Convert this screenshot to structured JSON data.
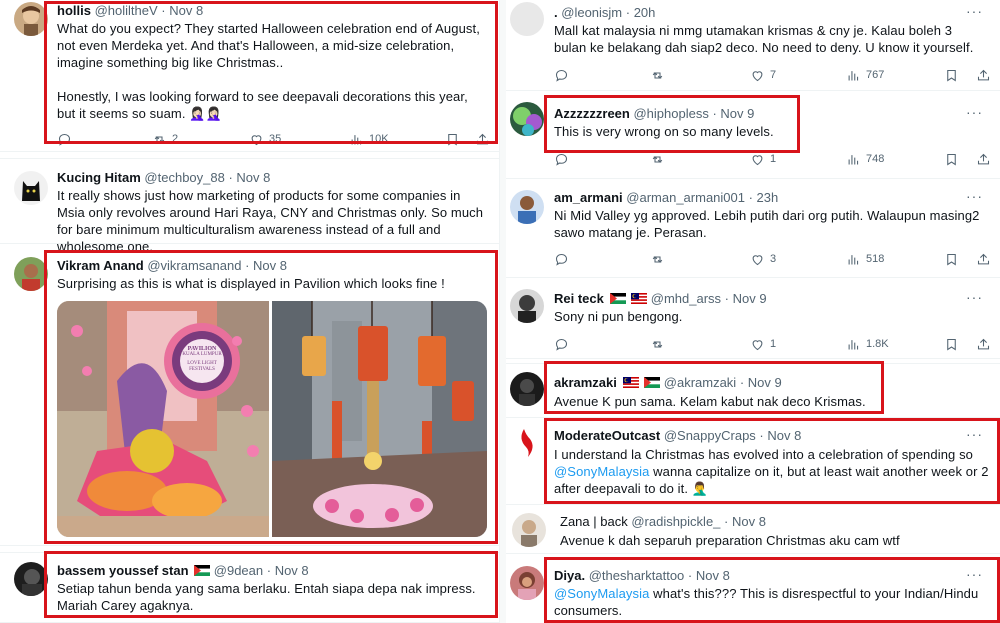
{
  "tweets_left": [
    {
      "id": "hollis",
      "name": "hollis",
      "handle": "@holiltheV",
      "date": "· Nov 8",
      "text": "What do you expect? They started Halloween celebration end of August, not even Merdeka yet. And that's Halloween, a mid-size celebration, imagine something big like Christmas..",
      "text2": "Honestly, I was looking forward to see deepavali decorations this year, but it seems so suam. 🤦🏻‍♀️🤦🏻‍♀️",
      "replies": "",
      "retweets": "2",
      "likes": "35",
      "views": "10K"
    },
    {
      "id": "kucing",
      "name": "Kucing Hitam",
      "handle": "@techboy_88",
      "date": "· Nov 8",
      "text": "It really shows just how marketing of products for some companies in Msia only revolves around Hari Raya, CNY and Christmas only. So much for bare minimum multiculturalism awareness instead of a full and wholesome one."
    },
    {
      "id": "vikram",
      "name": "Vikram Anand",
      "handle": "@vikramsanand",
      "date": "· Nov 8",
      "text": "Surprising as this is what is displayed in Pavilion which looks fine !",
      "sign_line1": "PAVILION",
      "sign_line2": "KUALA LUMPUR",
      "sign_line3": "LOVE LIGHT",
      "sign_line4": "FESTIVALS"
    },
    {
      "id": "bassem",
      "name": "bassem youssef stan",
      "handle": "@9dean",
      "date": "· Nov 8",
      "text": "Setiap tahun benda yang sama berlaku. Entah siapa depa nak impress. Mariah Carey agaknya."
    }
  ],
  "tweets_right": [
    {
      "id": "dot",
      "name": ".",
      "handle": "@leonisjm",
      "date": "· 20h",
      "text": "Mall kat malaysia ni mmg utamakan krismas & cny je. Kalau boleh 3 bulan ke belakang dah siap2 deco. No need to deny. U know it yourself.",
      "replies": "",
      "retweets": "",
      "likes": "7",
      "views": "767"
    },
    {
      "id": "azzz",
      "name": "Azzzzzzreen",
      "handle": "@hiphopless",
      "date": "· Nov 9",
      "text": "This is very wrong on so many levels.",
      "replies": "",
      "retweets": "",
      "likes": "1",
      "views": "748"
    },
    {
      "id": "armani",
      "name": "am_armani",
      "handle": "@arman_armani001",
      "date": "· 23h",
      "text": "Ni Mid Valley yg approved. Lebih  putih dari org putih. Walaupun masing2 sawo matang je. Perasan.",
      "replies": "",
      "retweets": "",
      "likes": "3",
      "views": "518"
    },
    {
      "id": "reiteck",
      "name": "Rei teck",
      "handle": "@mhd_arss",
      "date": "· Nov 9",
      "text": "Sony ni pun bengong.",
      "replies": "",
      "retweets": "",
      "likes": "1",
      "views": "1.8K"
    },
    {
      "id": "akram",
      "name": "akramzaki",
      "handle": "@akramzaki",
      "date": "· Nov 9",
      "text": "Avenue K pun sama. Kelam kabut nak deco Krismas."
    },
    {
      "id": "moderate",
      "name": "ModerateOutcast",
      "handle": "@SnappyCraps",
      "date": "· Nov 8",
      "text_a": "I understand la Christmas has evolved into a celebration of spending so",
      "mention": "@SonyMalaysia",
      "text_b": " wanna capitalize on it, but at least wait another week or 2 after deepavali to do it. 🤦‍♂️"
    },
    {
      "id": "zana",
      "name": "Zana | back",
      "handle": "@radishpickle_",
      "date": "· Nov 8",
      "text": "Avenue k dah separuh preparation Christmas aku cam wtf"
    },
    {
      "id": "diya",
      "name": "Diya.",
      "handle": "@thesharktattoo",
      "date": "· Nov 8",
      "mention": "@SonyMalaysia",
      "text_b": " what's this??? This is disrespectful to your Indian/Hindu consumers."
    }
  ],
  "more_label": "···",
  "colors": {
    "highlight": "#d8141b",
    "link": "#1d9bf0",
    "muted": "#536471"
  }
}
